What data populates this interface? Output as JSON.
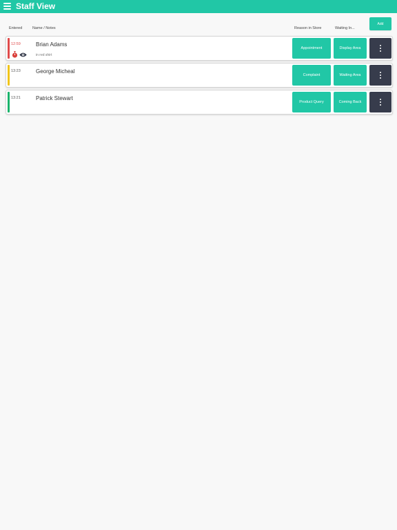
{
  "app": {
    "title": "Staff View"
  },
  "toolbar": {
    "add_label": "Add"
  },
  "columns": {
    "entered": "Entered",
    "name_notes": "Name / Notes",
    "reason": "Reason in Store",
    "waiting": "Waiting In..."
  },
  "icons": {
    "menu": "hamburger-menu-icon",
    "timer": "stopwatch-icon",
    "eye": "eye-icon",
    "more": "more-vertical-icon"
  },
  "colors": {
    "accent": "#21c7a6",
    "dark_button": "#373c4c",
    "status_red": "#e04b4b",
    "status_yellow": "#f0c419",
    "status_green": "#19b36b",
    "timer_red": "#d9403c",
    "eye_dark": "#2f3445"
  },
  "rows": [
    {
      "time": "12:59",
      "name": "Brian Adams",
      "note": "in red shirt",
      "reason": "Appointment",
      "waiting": "Display Area",
      "status_color": "#e04b4b",
      "time_color": "#e04b4b"
    },
    {
      "time": "13:23",
      "name": "George Micheal",
      "note": "",
      "reason": "Complaint",
      "waiting": "Waiting Area",
      "status_color": "#f0c419",
      "time_color": "#555555"
    },
    {
      "time": "13:21",
      "name": "Patrick Stewart",
      "note": "",
      "reason": "Product Query",
      "waiting": "Coming Back",
      "status_color": "#19b36b",
      "time_color": "#555555"
    }
  ]
}
